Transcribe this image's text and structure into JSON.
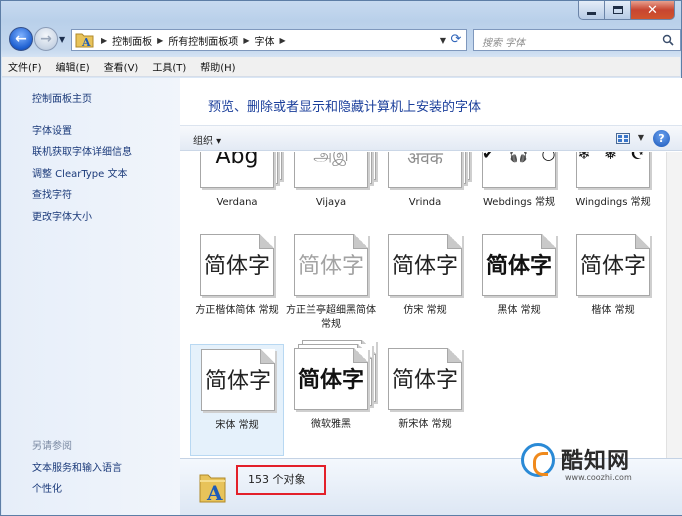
{
  "address_bar": {
    "breadcrumbs": [
      "控制面板",
      "所有控制面板项",
      "字体"
    ],
    "icon": "fonts-folder-icon"
  },
  "search": {
    "placeholder": "搜索 字体"
  },
  "menu": [
    "文件(F)",
    "编辑(E)",
    "查看(V)",
    "工具(T)",
    "帮助(H)"
  ],
  "sidebar": {
    "home": "控制面板主页",
    "links": [
      "字体设置",
      "联机获取字体详细信息",
      "调整 ClearType 文本",
      "查找字符",
      "更改字体大小"
    ],
    "see_also_header": "另请参阅",
    "see_also": [
      "文本服务和输入语言",
      "个性化"
    ]
  },
  "main": {
    "heading": "预览、删除或者显示和隐藏计算机上安装的字体",
    "organize_label": "组织 ▾",
    "help_label": "?"
  },
  "fonts": [
    {
      "preview": "Abg",
      "style": "latin",
      "stacked": true,
      "label": "Verdana"
    },
    {
      "preview": "அஇ",
      "style": "light",
      "stacked": true,
      "label": "Vijaya"
    },
    {
      "preview": "अवक",
      "style": "light",
      "stacked": true,
      "label": "Vrinda"
    },
    {
      "preview": "✔ 🎧 ○",
      "style": "sym",
      "stacked": false,
      "label": "Webdings 常规"
    },
    {
      "preview": "❄ ❅ ☪",
      "style": "sym",
      "stacked": false,
      "label": "Wingdings 常规"
    },
    {
      "preview": "简体字",
      "style": "cjk",
      "stacked": false,
      "label": "方正楷体简体 常规"
    },
    {
      "preview": "简体字",
      "style": "cjk-gray",
      "stacked": false,
      "label": "方正兰亭超细黑简体 常规"
    },
    {
      "preview": "简体字",
      "style": "cjk",
      "stacked": false,
      "label": "仿宋 常规"
    },
    {
      "preview": "简体字",
      "style": "cjk-bold",
      "stacked": false,
      "label": "黑体 常规"
    },
    {
      "preview": "简体字",
      "style": "cjk",
      "stacked": false,
      "label": "楷体 常规"
    },
    {
      "preview": "简体字",
      "style": "cjk",
      "stacked": false,
      "label": "宋体 常规",
      "selected": true
    },
    {
      "preview": "简体字",
      "style": "cjk-bold",
      "stacked": true,
      "label": "微软雅黑"
    },
    {
      "preview": "简体字",
      "style": "cjk",
      "stacked": false,
      "label": "新宋体 常规"
    }
  ],
  "details": {
    "item_count": "153 个对象"
  },
  "watermark": {
    "text": "酷知网",
    "url": "www.coozhi.com"
  },
  "colors": {
    "highlight_box": "#e3202a",
    "link": "#1b3a7a",
    "heading": "#1b3f9b"
  }
}
